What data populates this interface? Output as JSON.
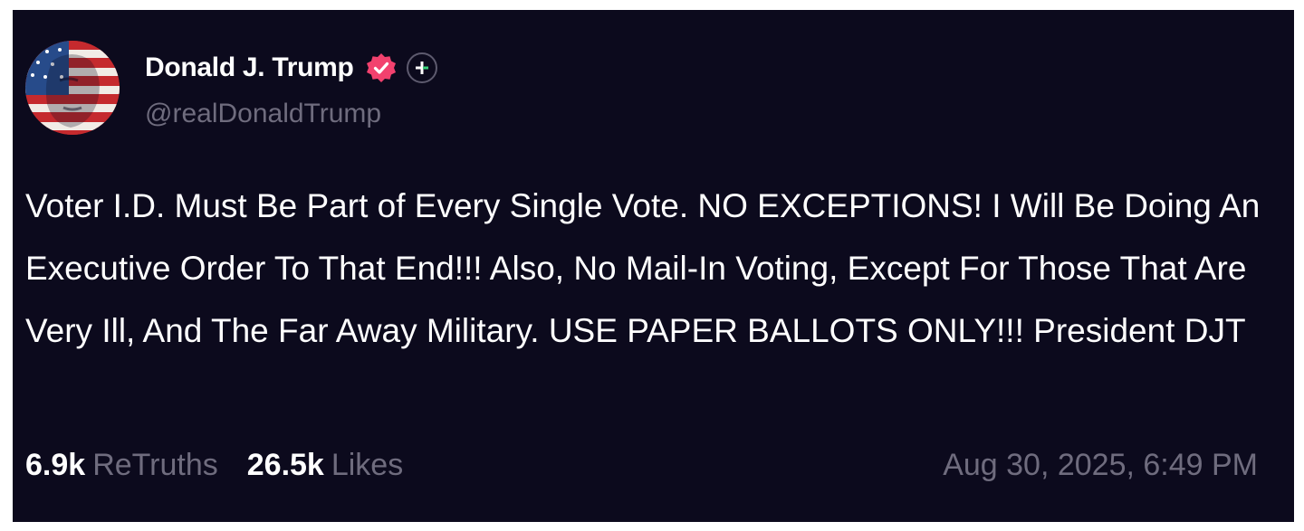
{
  "author": {
    "display_name": "Donald J. Trump",
    "handle": "@realDonaldTrump",
    "avatar_icon": "flag-portrait-avatar",
    "verified_icon": "verified-badge-icon",
    "follow_icon": "plus-icon"
  },
  "post": {
    "text": "Voter I.D. Must Be Part of Every Single Vote. NO EXCEPTIONS! I Will Be Doing An Executive Order To That End!!! Also, No Mail-In Voting, Except For Those That Are Very Ill, And The Far Away Military. USE PAPER BALLOTS ONLY!!! President DJT"
  },
  "stats": {
    "retruths_count": "6.9k",
    "retruths_label": "ReTruths",
    "likes_count": "26.5k",
    "likes_label": "Likes"
  },
  "timestamp": "Aug 30, 2025, 6:49 PM",
  "colors": {
    "card_background": "#0c0a1d",
    "text_primary": "#ffffff",
    "text_muted": "#6f6c7e",
    "verified_badge": "#f2416e",
    "plus_accent": "#3ad07a"
  }
}
